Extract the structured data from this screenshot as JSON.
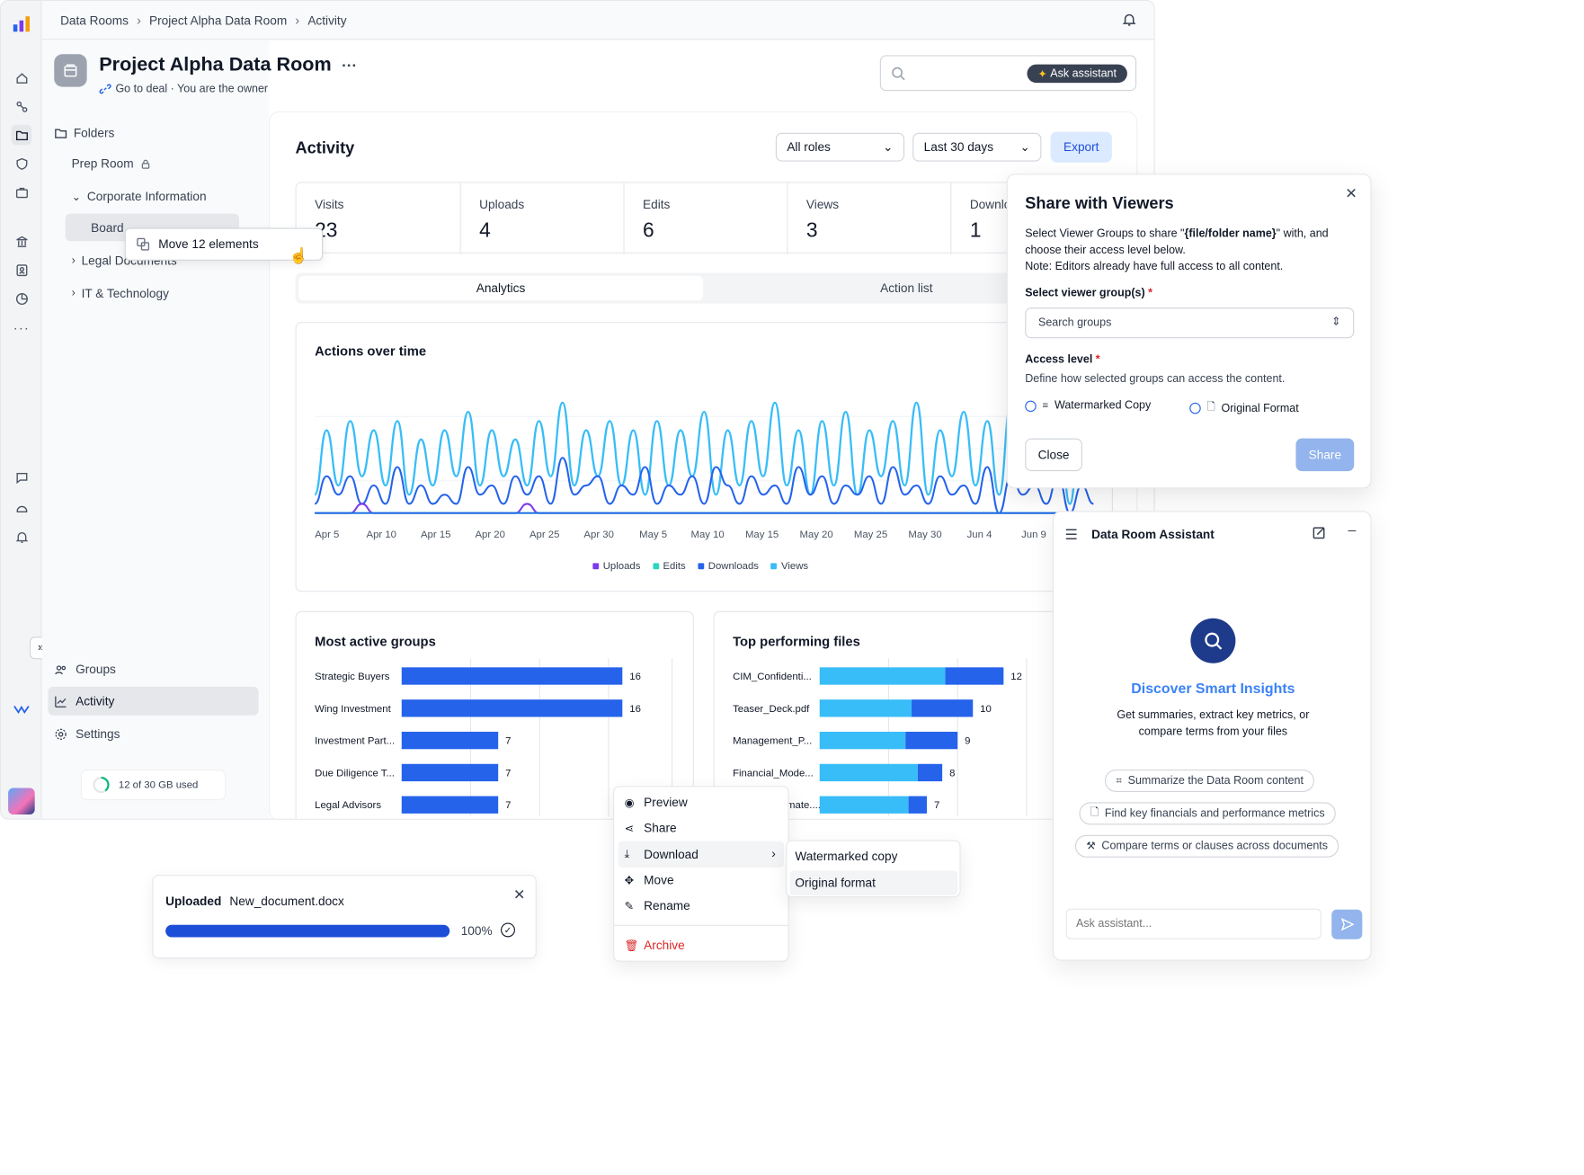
{
  "breadcrumbs": [
    "Data Rooms",
    "Project Alpha Data Room",
    "Activity"
  ],
  "room": {
    "title": "Project Alpha Data Room",
    "more": "···",
    "subtitle": "Go to deal · You are the owner"
  },
  "search": {
    "placeholder": "",
    "assistant_button": "Ask assistant"
  },
  "sidebar": {
    "folders_label": "Folders",
    "items": [
      {
        "label": "Prep Room"
      },
      {
        "label": "Corporate Information"
      },
      {
        "label": "Board"
      },
      {
        "label": "Legal Documents"
      },
      {
        "label": "IT & Technology"
      }
    ],
    "drag_tooltip": "Move 12 elements",
    "nav": [
      {
        "label": "Groups"
      },
      {
        "label": "Activity"
      },
      {
        "label": "Settings"
      }
    ],
    "storage": "12 of 30 GB used",
    "storage_fraction": 0.4
  },
  "activity": {
    "title": "Activity",
    "roles_filter": "All roles",
    "range_filter": "Last 30 days",
    "export": "Export",
    "stats": [
      {
        "label": "Visits",
        "value": "23"
      },
      {
        "label": "Uploads",
        "value": "4"
      },
      {
        "label": "Edits",
        "value": "6"
      },
      {
        "label": "Views",
        "value": "3"
      },
      {
        "label": "Downloads",
        "value": "1"
      }
    ],
    "tabs": [
      "Analytics",
      "Action list"
    ]
  },
  "share_dialog": {
    "title": "Share with Viewers",
    "desc_pre": "Select Viewer Groups to share \"",
    "desc_bold": "{file/folder name}",
    "desc_post": "\" with, and choose their access level below.",
    "note": "Note: Editors already have full access to all content.",
    "group_label": "Select viewer group(s)",
    "group_placeholder": "Search groups",
    "access_label": "Access level",
    "access_desc": "Define how selected groups can access the content.",
    "options": [
      "Watermarked Copy",
      "Original Format"
    ],
    "close": "Close",
    "share": "Share",
    "required_mark": "*"
  },
  "context_menu": {
    "items": [
      "Preview",
      "Share",
      "Download",
      "Move",
      "Rename",
      "Archive"
    ],
    "submenu": [
      "Watermarked copy",
      "Original format"
    ]
  },
  "upload_toast": {
    "status": "Uploaded",
    "file": "New_document.docx",
    "percent": "100%",
    "progress": 1.0
  },
  "assistant": {
    "title": "Data Room Assistant",
    "heading": "Discover Smart Insights",
    "body": "Get summaries, extract key metrics, or compare terms from your files",
    "suggestions": [
      "Summarize the Data Room content",
      "Find key financials and performance metrics",
      "Compare terms or clauses across documents"
    ],
    "input_placeholder": "Ask assistant..."
  },
  "colors": {
    "accent": "#2563eb",
    "sky": "#38bdf8",
    "purple": "#7c3aed",
    "teal": "#2dd4bf",
    "archive": "#dc2626"
  },
  "chart_data": [
    {
      "type": "line",
      "title": "Actions over time",
      "x": [
        "Apr 5",
        "Apr 10",
        "Apr 15",
        "Apr 20",
        "Apr 25",
        "Apr 30",
        "May 5",
        "May 10",
        "May 15",
        "May 20",
        "May 25",
        "May 30",
        "Jun 4",
        "Jun 9"
      ],
      "series": [
        {
          "name": "Uploads",
          "color": "#7c3aed",
          "values": [
            0,
            0,
            0,
            0,
            1,
            0,
            0,
            0,
            0,
            0,
            0,
            0,
            0,
            0,
            0,
            0,
            0,
            0,
            1,
            0,
            0,
            0,
            0,
            0,
            0,
            0,
            0,
            0,
            0,
            0,
            0,
            0,
            0,
            0,
            0,
            0,
            0,
            0,
            0,
            0,
            0,
            0,
            0,
            0,
            0,
            0,
            0,
            0,
            0,
            0,
            0,
            0,
            0,
            0,
            0,
            0,
            0,
            0,
            0,
            0,
            0,
            0,
            0,
            0,
            0,
            0,
            0
          ]
        },
        {
          "name": "Edits",
          "color": "#2dd4bf",
          "values": [
            0,
            0,
            0,
            0,
            0,
            0,
            0,
            0,
            0,
            0,
            0,
            0,
            0,
            0,
            0,
            0,
            0,
            0,
            0,
            0,
            0,
            0,
            0,
            0,
            0,
            0,
            0,
            0,
            0,
            0,
            0,
            0,
            0,
            0,
            0,
            0,
            0,
            0,
            0,
            0,
            0,
            0,
            0,
            0,
            0,
            0,
            0,
            0,
            0,
            0,
            0,
            0,
            0,
            0,
            0,
            0,
            0,
            0,
            0,
            0,
            0,
            0,
            0,
            0,
            0,
            0,
            0
          ]
        },
        {
          "name": "Downloads",
          "color": "#2563eb",
          "values": [
            1,
            4,
            2,
            4,
            1,
            3,
            1,
            5,
            1,
            3,
            1,
            2,
            1,
            5,
            2,
            3,
            1,
            4,
            2,
            4,
            1,
            6,
            2,
            3,
            4,
            1,
            3,
            2,
            5,
            1,
            3,
            2,
            4,
            1,
            5,
            3,
            1,
            4,
            2,
            3,
            1,
            5,
            2,
            4,
            1,
            3,
            2,
            4,
            1,
            5,
            2,
            3,
            1,
            4,
            2,
            3,
            1,
            5,
            0,
            4,
            2,
            3,
            1,
            4,
            0,
            3,
            1
          ]
        },
        {
          "name": "Views",
          "color": "#38bdf8",
          "values": [
            2,
            9,
            3,
            10,
            4,
            9,
            3,
            10,
            2,
            8,
            3,
            9,
            4,
            11,
            3,
            9,
            4,
            8,
            3,
            10,
            4,
            12,
            3,
            9,
            4,
            10,
            3,
            9,
            2,
            10,
            3,
            9,
            4,
            11,
            2,
            9,
            3,
            10,
            4,
            12,
            3,
            9,
            2,
            10,
            3,
            11,
            2,
            9,
            4,
            10,
            3,
            12,
            2,
            9,
            4,
            11,
            3,
            10,
            2,
            12,
            3,
            10,
            4,
            11,
            1,
            12,
            3
          ]
        }
      ],
      "ylim": [
        0,
        14
      ],
      "legend": "bottom"
    },
    {
      "type": "bar",
      "title": "Most active groups",
      "categories": [
        "Strategic Buyers",
        "Wing Investment",
        "Investment Part...",
        "Due Diligence T...",
        "Legal Advisors"
      ],
      "values": [
        16,
        16,
        7,
        7,
        7
      ],
      "xlim": [
        0,
        20
      ]
    },
    {
      "type": "bar",
      "title": "Top performing files",
      "categories": [
        "CIM_Confidenti...",
        "Teaser_Deck.pdf",
        "Management_P...",
        "Financial_Mode...",
        "Pricing_Estimate...."
      ],
      "series": [
        {
          "name": "part1",
          "values": [
            8.2,
            6,
            5.6,
            6.4,
            5.8
          ]
        },
        {
          "name": "part2",
          "values": [
            3.8,
            4,
            3.4,
            1.6,
            1.2
          ]
        }
      ],
      "totals": [
        12,
        10,
        9,
        8,
        7
      ],
      "xlim": [
        0,
        18
      ]
    }
  ]
}
